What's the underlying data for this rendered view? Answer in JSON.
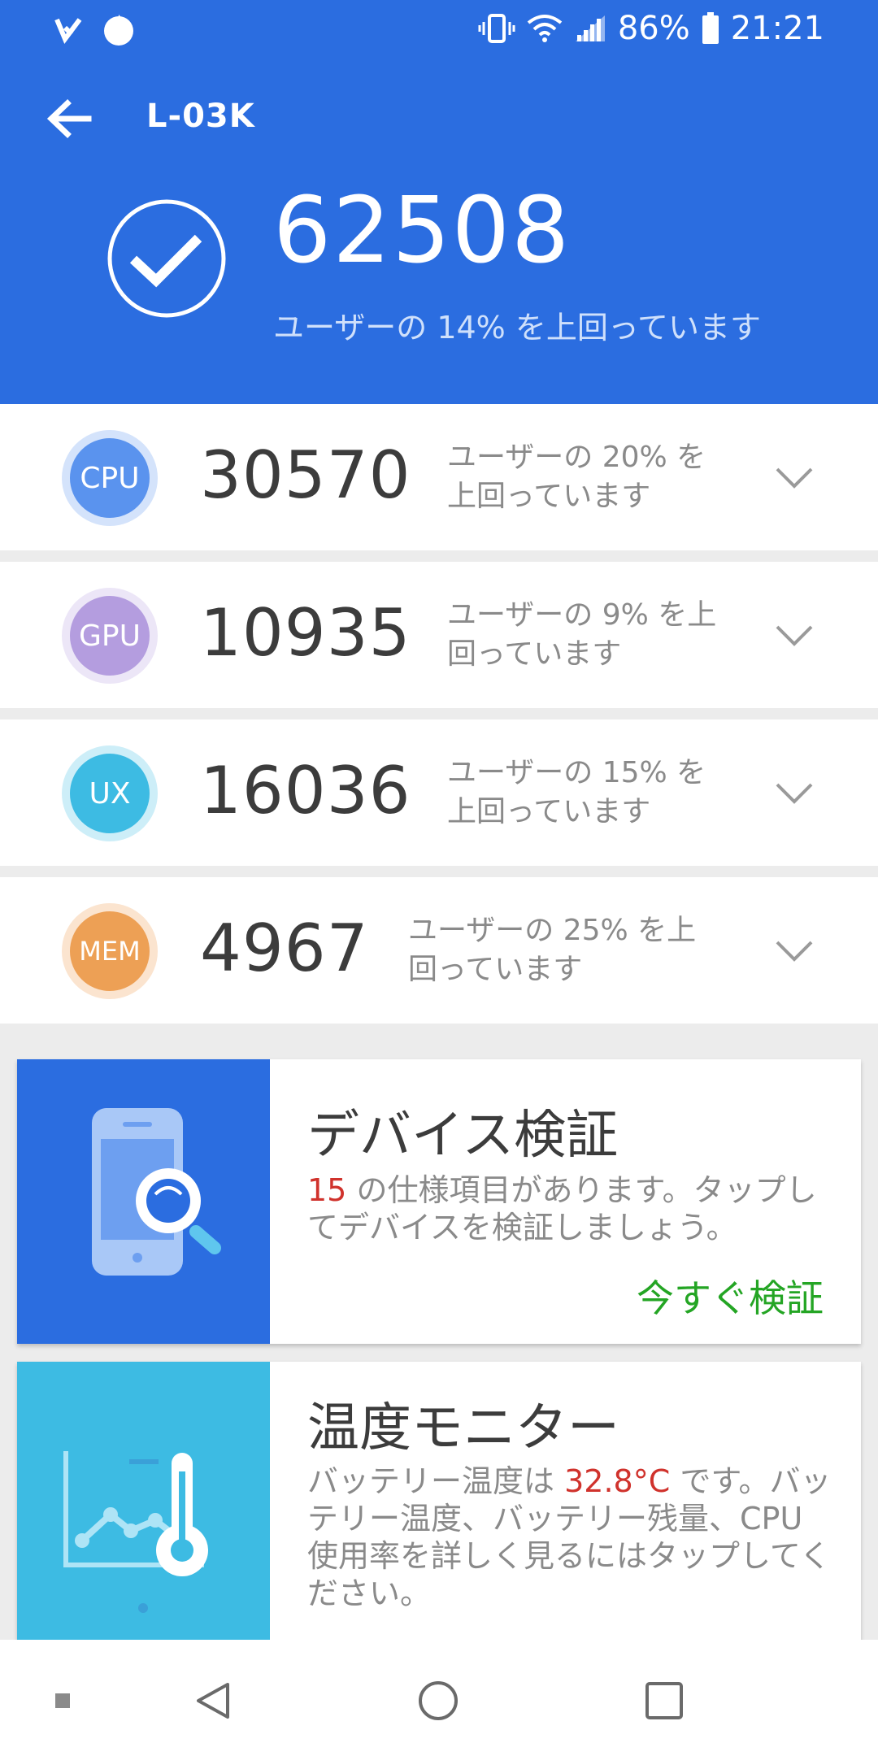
{
  "status_bar": {
    "battery_percent": "86%",
    "time": "21:21",
    "left_icons": [
      "notification-app-icon",
      "fire-app-icon"
    ],
    "right_icons": [
      "vibrate-icon",
      "wifi-icon",
      "signal-icon",
      "battery-icon"
    ]
  },
  "app_bar": {
    "title": "L-03K",
    "back_icon": "arrow-left-icon"
  },
  "total_score": {
    "value": "62508",
    "subtitle": "ユーザーの 14% を上回っています",
    "icon": "check-circle-icon"
  },
  "results": [
    {
      "badge": "CPU",
      "score": "30570",
      "desc": "ユーザーの 20% を上回っています",
      "color": "#5a93ee",
      "ring": "#d4e3fb"
    },
    {
      "badge": "GPU",
      "score": "10935",
      "desc": "ユーザーの 9% を上回っています",
      "color": "#b49ddf",
      "ring": "#ece6f7"
    },
    {
      "badge": "UX",
      "score": "16036",
      "desc": "ユーザーの 15% を上回っています",
      "color": "#3dbbe3",
      "ring": "#cdeef8"
    },
    {
      "badge": "MEM",
      "score": "4967",
      "desc": "ユーザーの 25% を上回っています",
      "color": "#eda055",
      "ring": "#fbe4cf"
    }
  ],
  "device_check": {
    "title": "デバイス検証",
    "count": "15",
    "text": " の仕様項目があります。タップしてデバイスを検証しましょう。",
    "action": "今すぐ検証",
    "art_color": "#2b6de0"
  },
  "temp_monitor": {
    "title": "温度モニター",
    "text_before": "バッテリー温度は ",
    "temperature": "32.8°C",
    "text_after": " です。バッテリー温度、バッテリー残量、CPU 使用率を詳しく見るにはタップしてください。",
    "art_color": "#3dbbe3"
  },
  "nav_bar": {
    "icons": [
      "dot-icon",
      "back-triangle-icon",
      "home-circle-icon",
      "recents-square-icon"
    ]
  },
  "colors": {
    "header_blue": "#2b6de0",
    "action_green": "#24a524",
    "highlight_red": "#d0322c"
  }
}
